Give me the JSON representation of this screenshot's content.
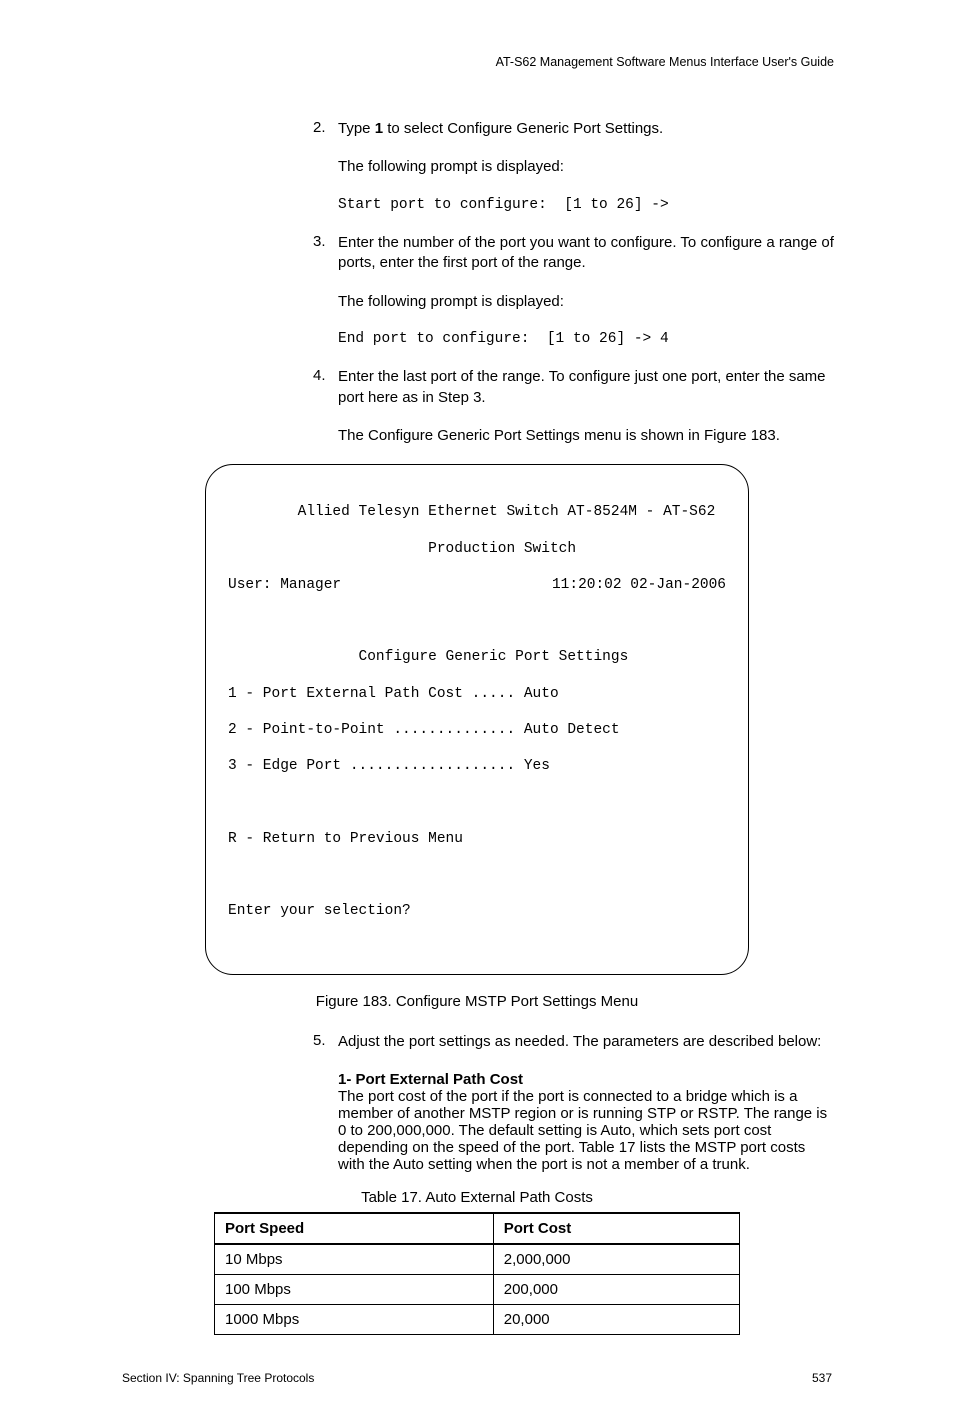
{
  "header": {
    "title": "AT-S62 Management Software Menus Interface User's Guide"
  },
  "steps": {
    "s2": {
      "num": "2.",
      "line1a": "Type ",
      "line1b": "1",
      "line1c": " to select Configure Generic Port Settings.",
      "line2": "The following prompt is displayed:",
      "code": "Start port to configure:  [1 to 26] ->"
    },
    "s3": {
      "num": "3.",
      "line1": "Enter the number of the port you want to configure. To configure a range of ports, enter the first port of the range.",
      "line2": "The following prompt is displayed:",
      "code": "End port to configure:  [1 to 26] -> 4"
    },
    "s4": {
      "num": "4.",
      "line1": "Enter the last port of the range. To configure just one port, enter the same port here as in Step 3.",
      "line2": "The Configure Generic Port Settings menu is shown in Figure 183."
    },
    "s5": {
      "num": "5.",
      "line1": "Adjust the port settings as needed. The parameters are described below:"
    }
  },
  "terminal": {
    "l1": "        Allied Telesyn Ethernet Switch AT-8524M - AT-S62",
    "l2": "                       Production Switch",
    "l3a": "User: Manager",
    "l3b": "11:20:02 02-Jan-2006",
    "l4": "               Configure Generic Port Settings",
    "l5": "1 - Port External Path Cost ..... Auto",
    "l6": "2 - Point-to-Point .............. Auto Detect",
    "l7": "3 - Edge Port ................... Yes",
    "l8": "R - Return to Previous Menu",
    "l9": "Enter your selection?"
  },
  "figure_caption": "Figure 183. Configure MSTP Port Settings Menu",
  "param1": {
    "head": "1- Port External Path Cost",
    "body": "The port cost of the port if the port is connected to a bridge which is a member of another MSTP region or is running STP or RSTP. The range is 0 to 200,000,000. The default setting is Auto, which sets port cost depending on the speed of the port. Table 17 lists the MSTP port costs with the Auto setting when the port is not a member of a trunk."
  },
  "table": {
    "caption": "Table 17. Auto External Path Costs",
    "h1": "Port Speed",
    "h2": "Port Cost",
    "rows": [
      {
        "c1": "10 Mbps",
        "c2": "2,000,000"
      },
      {
        "c1": "100 Mbps",
        "c2": "200,000"
      },
      {
        "c1": "1000 Mbps",
        "c2": "20,000"
      }
    ]
  },
  "footer": {
    "left": "Section IV: Spanning Tree Protocols",
    "right": "537"
  }
}
